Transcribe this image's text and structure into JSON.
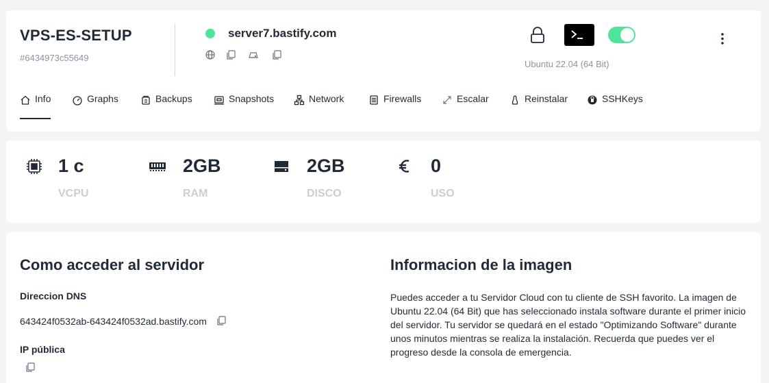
{
  "server": {
    "name": "VPS-ES-SETUP",
    "id": "#6434973c55649",
    "hostname": "server7.bastify.com",
    "os": "Ubuntu 22.04 (64 Bit)",
    "status_color": "#4ee49a",
    "power_on": true,
    "host_icons": [
      "globe-icon",
      "copy-icon",
      "drive-icon",
      "copy-icon"
    ]
  },
  "header_actions": {
    "icons": [
      "lock-icon",
      "terminal-icon",
      "power-toggle",
      "more-options-icon"
    ]
  },
  "tabs": [
    {
      "label": "Info",
      "icon": "home-icon",
      "active": true
    },
    {
      "label": "Graphs",
      "icon": "gauge-icon"
    },
    {
      "label": "Backups",
      "icon": "archive-icon"
    },
    {
      "label": "Snapshots",
      "icon": "camera-icon"
    },
    {
      "label": "Network",
      "icon": "network-icon"
    },
    {
      "label": "Firewalls",
      "icon": "firewall-icon"
    },
    {
      "label": "Escalar",
      "icon": "expand-icon"
    },
    {
      "label": "Reinstalar",
      "icon": "linux-icon"
    },
    {
      "label": "SSHKeys",
      "icon": "key-icon"
    }
  ],
  "stats": [
    {
      "value": "1 c",
      "label": "VCPU",
      "icon": "cpu-icon"
    },
    {
      "value": "2GB",
      "label": "RAM",
      "icon": "ram-icon"
    },
    {
      "value": "2GB",
      "label": "DISCO",
      "icon": "disk-icon"
    },
    {
      "value": "0",
      "label": "USO",
      "icon": "euro-icon"
    }
  ],
  "access": {
    "title": "Como acceder al servidor",
    "dns_label": "Direccion DNS",
    "dns_value": "643424f0532ab-643424f0532ad.bastify.com",
    "ip_label": "IP pública",
    "ip_value": ""
  },
  "image_info": {
    "title": "Informacion de la imagen",
    "paragraph": "Puedes acceder a tu Servidor Cloud con tu cliente de SSH favorito. La imagen de Ubuntu 22.04 (64 Bit) que has seleccionado instala software durante el primer inicio del servidor. Tu servidor se quedará en el estado \"Optimizando Software\" durante unos minutos mientras se realiza la instalación. Recuerda que puedes ver el progreso desde la consola de emergencia."
  },
  "colors": {
    "background": "#f3f4f6",
    "card": "#ffffff",
    "text": "#1f2a37",
    "muted": "#8a94a3",
    "accent_green": "#4ee49a"
  }
}
